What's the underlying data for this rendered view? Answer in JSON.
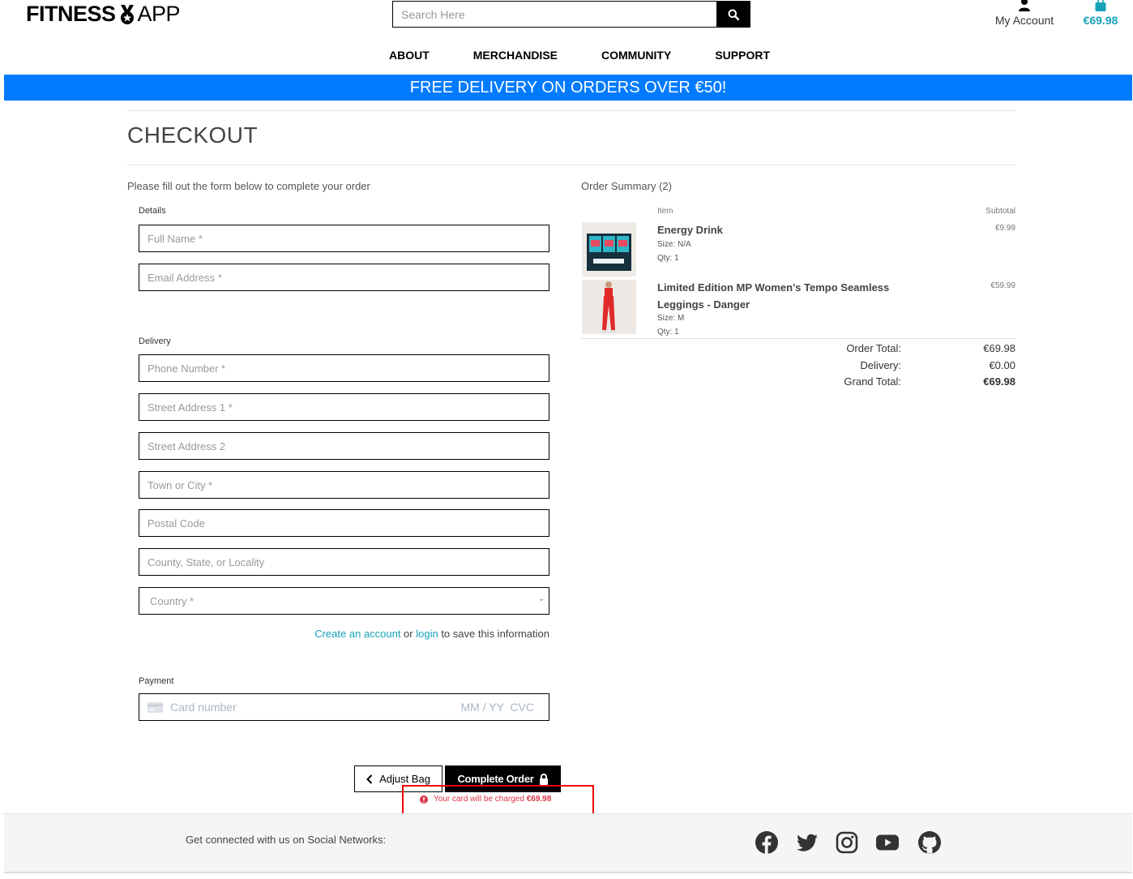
{
  "brand": {
    "name_bold": "FITNESS",
    "name_rest": "APP"
  },
  "search": {
    "placeholder": "Search Here"
  },
  "account": {
    "label": "My Account"
  },
  "bag": {
    "total": "€69.98"
  },
  "nav": {
    "items": [
      "ABOUT",
      "MERCHANDISE",
      "COMMUNITY",
      "SUPPORT"
    ]
  },
  "banner": {
    "text": "FREE DELIVERY ON ORDERS OVER €50!"
  },
  "checkout": {
    "title": "CHECKOUT",
    "intro": "Please fill out the form below to complete your order",
    "details_label": "Details",
    "delivery_label": "Delivery",
    "payment_label": "Payment",
    "fields": {
      "full_name": "Full Name *",
      "email": "Email Address *",
      "phone": "Phone Number *",
      "street1": "Street Address 1 *",
      "street2": "Street Address 2",
      "town": "Town or City *",
      "postal": "Postal Code",
      "county": "County, State, or Locality",
      "country": "Country *"
    },
    "save_info": {
      "create_link": "Create an account",
      "or": " or ",
      "login_link": "login",
      "rest": " to save this information"
    },
    "card": {
      "number_placeholder": "Card number",
      "rest_placeholder": "MM / YY  CVC"
    },
    "adjust_bag": "Adjust Bag",
    "complete_order": "Complete Order",
    "charge_text": "Your card will be charged ",
    "charge_amount": "€69.98"
  },
  "summary": {
    "title": "Order Summary (2)",
    "col_item": "Item",
    "col_subtotal": "Subtotal",
    "items": [
      {
        "name": "Energy Drink",
        "size": "Size: N/A",
        "qty": "Qty: 1",
        "price": "€9.99"
      },
      {
        "name": "Limited Edition MP Women's Tempo Seamless Leggings - Danger",
        "size": "Size: M",
        "qty": "Qty: 1",
        "price": "€59.99"
      }
    ],
    "order_total_label": "Order Total:",
    "order_total": "€69.98",
    "delivery_label": "Delivery:",
    "delivery": "€0.00",
    "grand_total_label": "Grand Total:",
    "grand_total": "€69.98"
  },
  "footer": {
    "social_text": "Get connected with us on Social Networks:"
  },
  "colors": {
    "accent": "#17a2b8",
    "banner": "#007bff",
    "error": "#dc3545"
  }
}
